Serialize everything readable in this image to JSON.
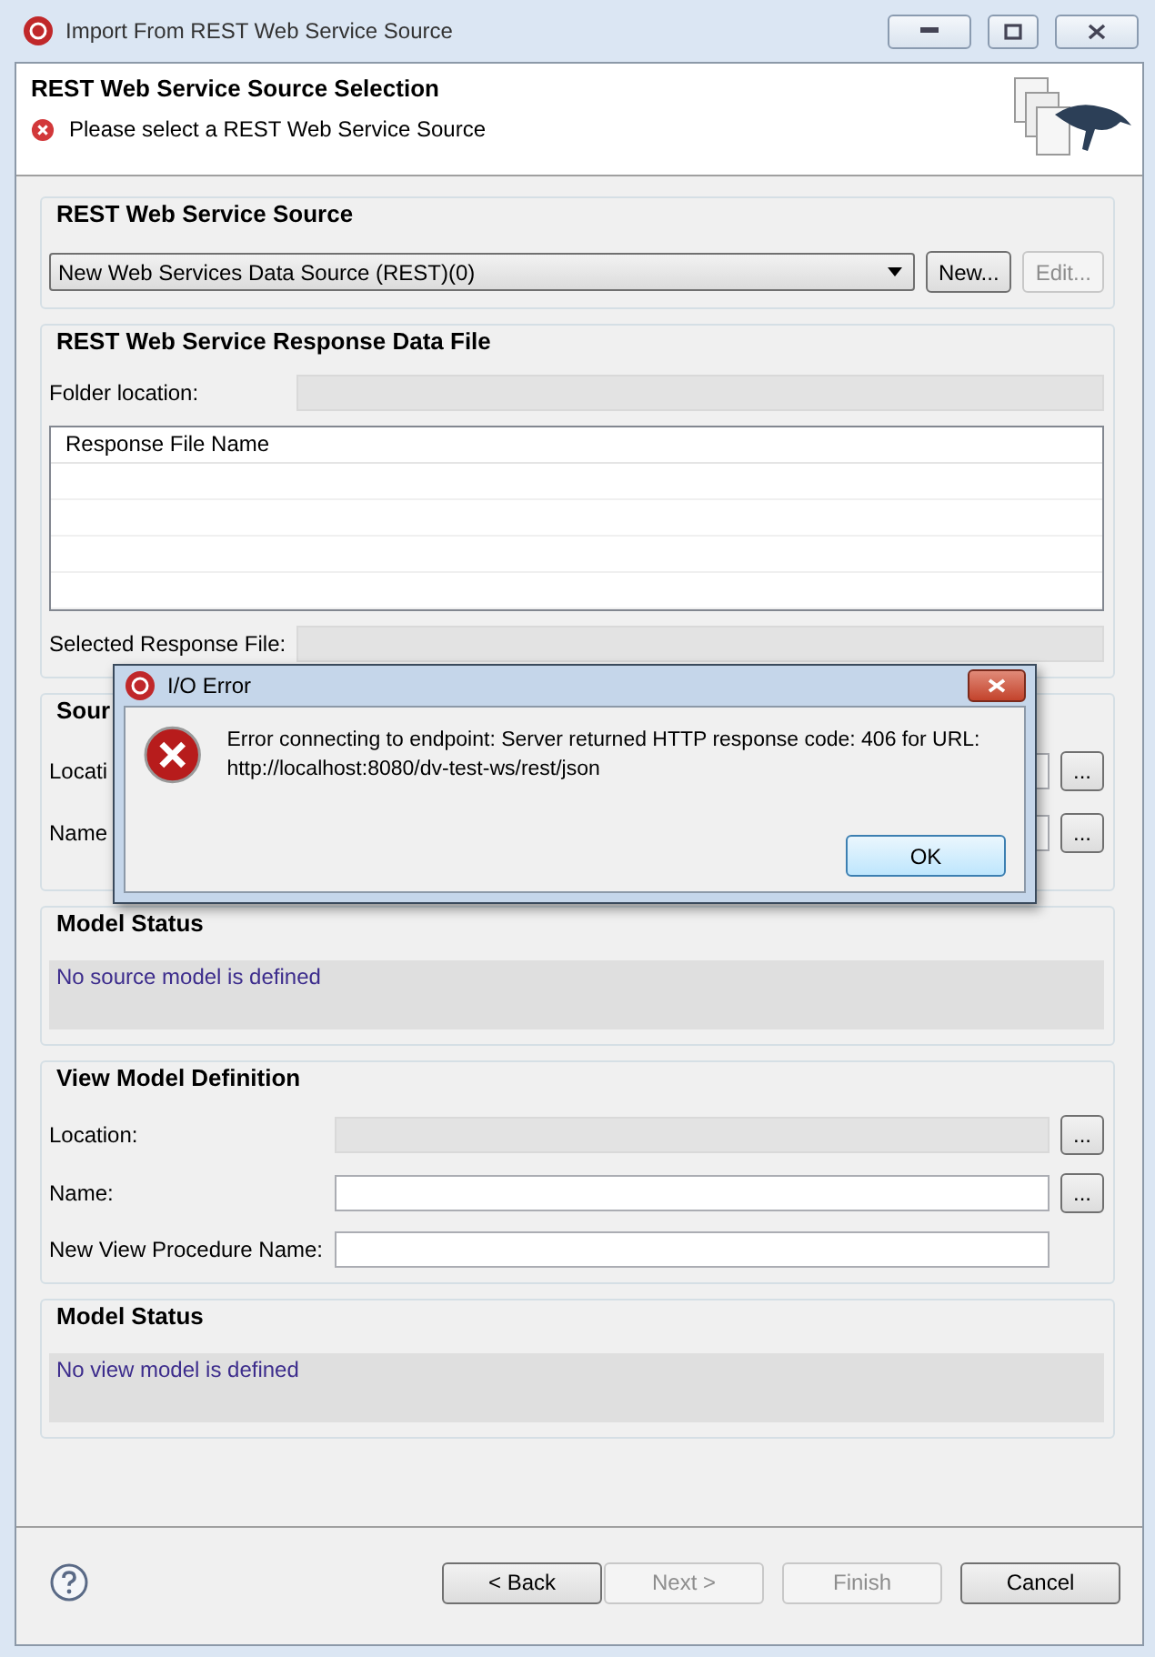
{
  "window": {
    "title": "Import From REST Web Service Source"
  },
  "header": {
    "title": "REST Web Service Source Selection",
    "message": "Please select a REST Web Service Source"
  },
  "groups": [
    {
      "title": "REST Web Service Source",
      "rows": [
        {
          "kind": "combo",
          "value": "New Web Services Data Source (REST)(0)",
          "buttons": [
            {
              "label": "New...",
              "disabled": false
            },
            {
              "label": "Edit...",
              "disabled": true
            }
          ]
        }
      ]
    },
    {
      "title": "REST Web Service Response Data File",
      "rows": [
        {
          "kind": "field",
          "label": "Folder location:",
          "disabled": true
        },
        {
          "kind": "table",
          "column": "Response File Name"
        },
        {
          "kind": "field",
          "label": "Selected Response File:",
          "disabled": true
        }
      ]
    },
    {
      "title": "Sour",
      "rows": [
        {
          "kind": "field",
          "label": "Locati",
          "browse": "..."
        },
        {
          "kind": "field",
          "label": "Name",
          "browse": "..."
        }
      ]
    },
    {
      "title": "Model Status",
      "rows": [
        {
          "kind": "status",
          "text": "No source model is defined"
        }
      ]
    },
    {
      "title": "View Model Definition",
      "rows": [
        {
          "kind": "field",
          "label": "Location:",
          "disabled": true,
          "browse": "..."
        },
        {
          "kind": "field",
          "label": "Name:",
          "disabled": false,
          "browse": "..."
        },
        {
          "kind": "field",
          "label": "New View Procedure Name:",
          "disabled": false
        }
      ]
    },
    {
      "title": "Model Status",
      "rows": [
        {
          "kind": "status",
          "text": "No view model is defined"
        }
      ]
    }
  ],
  "buttons": [
    {
      "label": "< Back",
      "disabled": false
    },
    {
      "label": "Next >",
      "disabled": true
    },
    {
      "label": "Finish",
      "disabled": true
    },
    {
      "label": "Cancel",
      "disabled": false
    }
  ],
  "dialog": {
    "title": "I/O Error",
    "message": "Error connecting to endpoint: Server returned HTTP response code: 406 for URL: http://localhost:8080/dv-test-ws/rest/json",
    "button": "OK"
  }
}
